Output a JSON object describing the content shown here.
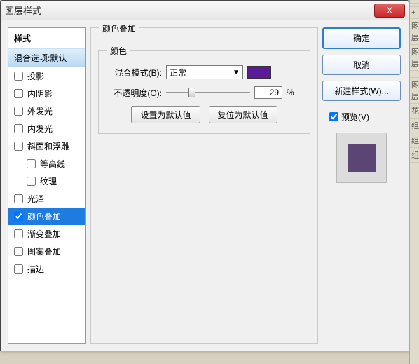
{
  "window": {
    "title": "图层样式",
    "close_label": "X"
  },
  "styles_panel": {
    "header": "样式",
    "blend_default": "混合选项:默认",
    "items": [
      {
        "label": "投影",
        "checked": false,
        "indent": false,
        "selected": false
      },
      {
        "label": "内阴影",
        "checked": false,
        "indent": false,
        "selected": false
      },
      {
        "label": "外发光",
        "checked": false,
        "indent": false,
        "selected": false
      },
      {
        "label": "内发光",
        "checked": false,
        "indent": false,
        "selected": false
      },
      {
        "label": "斜面和浮雕",
        "checked": false,
        "indent": false,
        "selected": false
      },
      {
        "label": "等高线",
        "checked": false,
        "indent": true,
        "selected": false
      },
      {
        "label": "纹理",
        "checked": false,
        "indent": true,
        "selected": false
      },
      {
        "label": "光泽",
        "checked": false,
        "indent": false,
        "selected": false
      },
      {
        "label": "颜色叠加",
        "checked": true,
        "indent": false,
        "selected": true
      },
      {
        "label": "渐变叠加",
        "checked": false,
        "indent": false,
        "selected": false
      },
      {
        "label": "图案叠加",
        "checked": false,
        "indent": false,
        "selected": false
      },
      {
        "label": "描边",
        "checked": false,
        "indent": false,
        "selected": false
      }
    ]
  },
  "center": {
    "group_title": "颜色叠加",
    "inner_title": "颜色",
    "blend_mode_label": "混合模式(B):",
    "blend_mode_value": "正常",
    "color_hex": "#5a1a9a",
    "opacity_label": "不透明度(O):",
    "opacity_value": "29",
    "opacity_unit": "%",
    "set_default_btn": "设置为默认值",
    "reset_default_btn": "复位为默认值"
  },
  "right": {
    "ok": "确定",
    "cancel": "取消",
    "new_style": "新建样式(W)...",
    "preview_label": "预览(V)",
    "preview_checked": true,
    "preview_color": "#5a4575"
  },
  "gutter_items": [
    "",
    "",
    "+",
    "图层",
    "图层",
    "",
    "",
    "图层",
    "花",
    "组",
    "组",
    "组"
  ]
}
